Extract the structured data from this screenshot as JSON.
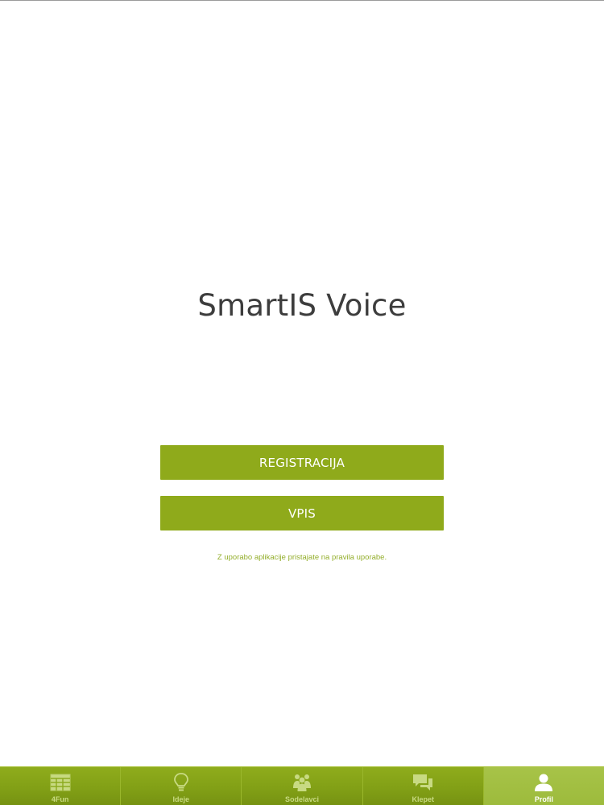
{
  "app": {
    "title": "SmartIS Voice"
  },
  "buttons": {
    "register_label": "REGISTRACIJA",
    "login_label": "VPIS"
  },
  "terms": {
    "text": "Z uporabo aplikacije pristajate na pravila uporabe."
  },
  "colors": {
    "accent": "#8faa1b",
    "tabbar": "#82a016",
    "tab_active": "#a3bf42",
    "title_text": "#3d3d3d"
  },
  "tabbar": {
    "active_tab": "Profil",
    "tabs": [
      {
        "label": "4Fun",
        "icon": "table-icon"
      },
      {
        "label": "Ideje",
        "icon": "lightbulb-icon"
      },
      {
        "label": "Sodelavci",
        "icon": "people-icon"
      },
      {
        "label": "Klepet",
        "icon": "chat-bubbles-icon"
      },
      {
        "label": "Profil",
        "icon": "person-icon"
      }
    ]
  }
}
